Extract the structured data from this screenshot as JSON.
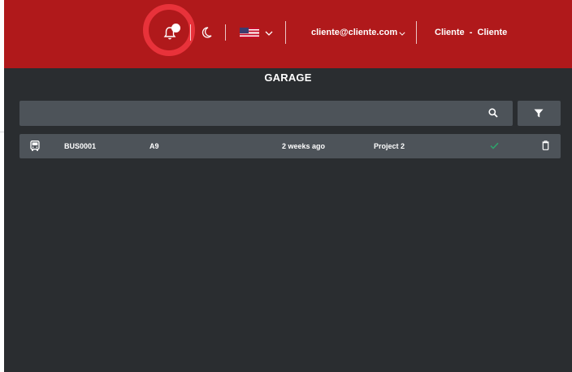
{
  "header": {
    "bell_icon": "bell-icon",
    "theme_icon": "moon-icon",
    "language": {
      "flag": "us-flag",
      "chevron": "chevron-down-icon"
    },
    "account_email": "cliente@cliente.com",
    "account_chevron": "chevron-down-icon",
    "user_name": "Cliente  -  Cliente"
  },
  "page": {
    "title": "GARAGE"
  },
  "search": {
    "placeholder": "",
    "icon": "search-icon"
  },
  "filter": {
    "icon": "filter-icon"
  },
  "rows": [
    {
      "type_icon": "bus-icon",
      "code": "BUS0001",
      "model": "A9",
      "updated": "2 weeks ago",
      "project": "Project 2",
      "status_icon": "check-icon",
      "delete_icon": "trash-icon"
    }
  ],
  "colors": {
    "header_bg": "#b0191b",
    "highlight_ring": "#e8323a",
    "page_bg": "#2a2d30",
    "panel_bg": "#4d5359",
    "status_ok": "#2ea36b"
  }
}
